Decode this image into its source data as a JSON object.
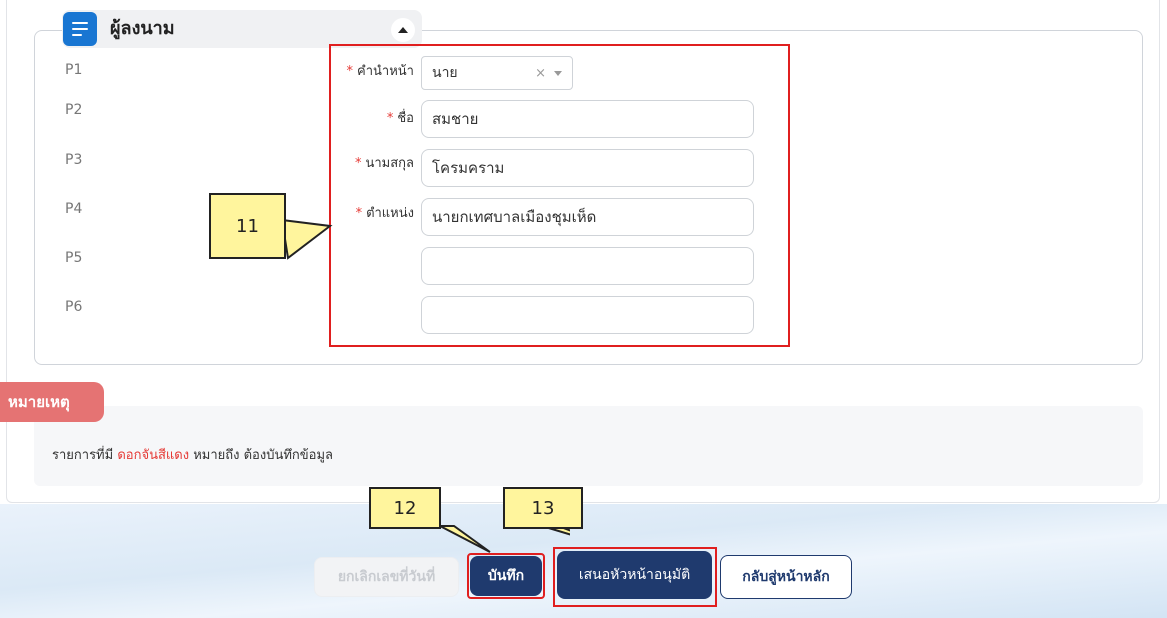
{
  "section": {
    "title": "ผู้ลงนาม"
  },
  "positions": [
    "P1",
    "P2",
    "P3",
    "P4",
    "P5",
    "P6"
  ],
  "form": {
    "prefix_label": "คำนำหน้า",
    "prefix_value": "นาย",
    "firstname_label": "ชื่อ",
    "firstname_value": "สมชาย",
    "lastname_label": "นามสกุล",
    "lastname_value": "โครมคราม",
    "position_label": "ตำแหน่ง",
    "position_value": "นายกเทศบาลเมืองชุมเห็ด",
    "extra1_value": "",
    "extra2_value": "",
    "required_mark": "*",
    "clear_glyph": "×"
  },
  "note": {
    "tab_label": "หมายเหตุ",
    "text_before": "รายการที่มี ",
    "text_red": "ดอกจันสีแดง",
    "text_after": " หมายถึง ต้องบันทึกข้อมูล"
  },
  "buttons": {
    "cancel_number": "ยกเลิกเลขที่วันที่",
    "save": "บันทึก",
    "submit_approval": "เสนอหัวหน้าอนุมัติ",
    "back_home": "กลับสู่หน้าหลัก"
  },
  "callouts": [
    "11",
    "12",
    "13"
  ],
  "colors": {
    "primary": "#1f3a6e",
    "header_icon": "#1976d2",
    "required": "#e53935",
    "note_tab": "#e57373",
    "highlight": "#e01f1f",
    "callout_fill": "#fff59d"
  },
  "icons": {
    "section": "list-icon",
    "collapse": "chevron-up-icon",
    "select_arrow": "caret-down-icon"
  }
}
